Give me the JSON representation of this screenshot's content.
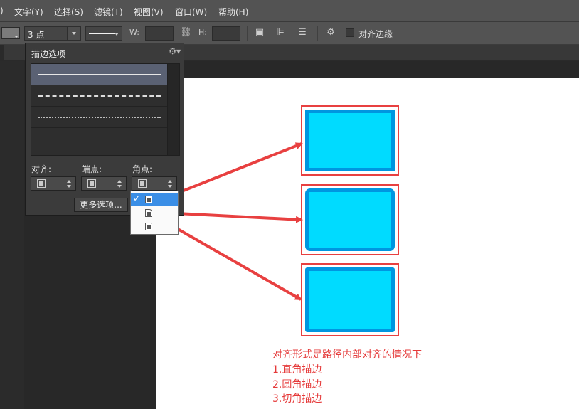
{
  "menu": {
    "items": [
      ")",
      "文字(Y)",
      "选择(S)",
      "滤镜(T)",
      "视图(V)",
      "窗口(W)",
      "帮助(H)"
    ]
  },
  "toolbar": {
    "stroke_size": "3 点",
    "w_label": "W:",
    "h_label": "H:",
    "align_edges_label": "对齐边缘"
  },
  "stroke_panel": {
    "title": "描边选项",
    "align_label": "对齐:",
    "caps_label": "端点:",
    "corners_label": "角点:",
    "more_button": "更多选项..."
  },
  "corner_popup": {
    "check": "✓"
  },
  "annotation": {
    "lines": [
      "对齐形式是路径内部对齐的情况下",
      "1.直角描边",
      "2.圆角描边",
      "3.切角描边"
    ]
  },
  "colors": {
    "red": "#e84040",
    "cyan_fill": "#00dbff",
    "blue_stroke": "#0096e0"
  }
}
